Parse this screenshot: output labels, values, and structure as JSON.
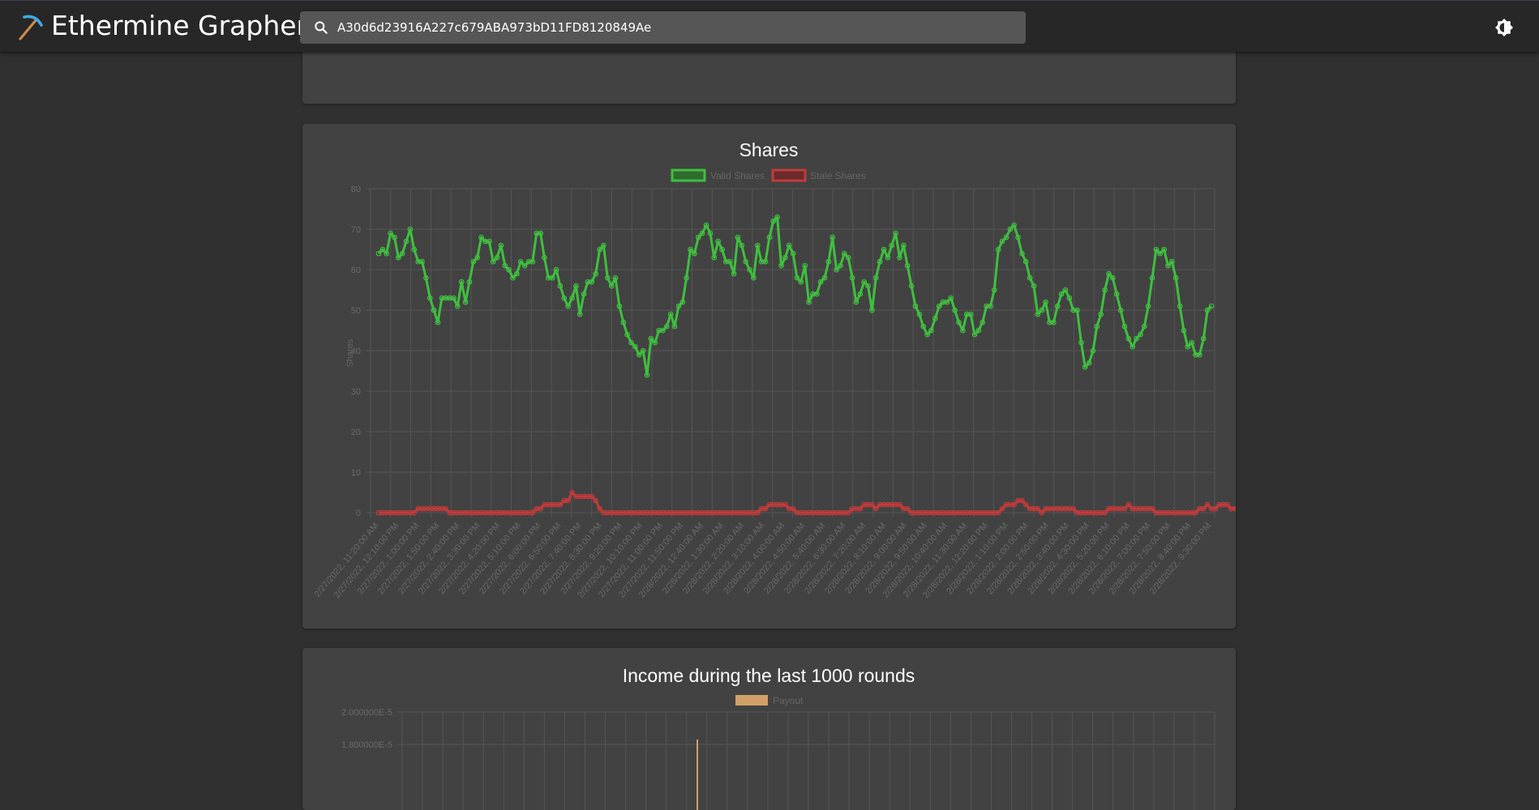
{
  "app": {
    "title": "Ethermine Grapher"
  },
  "search": {
    "value": "A30d6d23916A227c679ABA973bD11FD8120849Ae",
    "placeholder": ""
  },
  "icons": {
    "logo": "pickaxe-icon",
    "search": "search-icon",
    "theme": "brightness-icon"
  },
  "colors": {
    "valid": "#3fbf3f",
    "stale": "#c23b3b",
    "payout": "#d0a068",
    "grid": "#555555",
    "tick": "#6a6a6a"
  },
  "top_chart": {
    "tick_labels": [
      "2/27/2022",
      "2/27/2022",
      "2/27/2022",
      "2/27/2022",
      "2/27/2022",
      "2/27/2022",
      "2/27/2022",
      "2/27/2022",
      "2/27/2022",
      "2/27/2022",
      "2/27/2022",
      "2/27/2022",
      "2/27/2022",
      "2/27/2022",
      "2/28/2022",
      "2/28/2022",
      "2/28/2022",
      "2/28/2022",
      "2/28/2022",
      "2/28/2022",
      "2/28/2022",
      "2/28/2022",
      "2/28/2022",
      "2/28/2022",
      "2/28/2022",
      "2/28/2022",
      "2/28/2022",
      "2/28/2022",
      "2/28/2022",
      "2/28/2022",
      "2/28/2022",
      "2/28/2022",
      "2/28/2022",
      "2/28/2022",
      "2/28/2022"
    ]
  },
  "chart_data": [
    {
      "type": "line",
      "title": "Shares",
      "ylabel": "Shares",
      "ylim": [
        0,
        80
      ],
      "yticks": [
        80,
        70,
        60,
        50,
        40,
        30,
        20,
        10,
        0
      ],
      "grid": true,
      "legend_placement": "top",
      "x_ticks": [
        "2/27/2022, 11:20:00 AM",
        "2/27/2022, 12:10:00 PM",
        "2/27/2022, 1:00:00 PM",
        "2/27/2022, 1:50:00 PM",
        "2/27/2022, 2:40:00 PM",
        "2/27/2022, 3:30:00 PM",
        "2/27/2022, 4:20:00 PM",
        "2/27/2022, 5:10:00 PM",
        "2/27/2022, 6:00:00 PM",
        "2/27/2022, 6:50:00 PM",
        "2/27/2022, 7:40:00 PM",
        "2/27/2022, 8:30:00 PM",
        "2/27/2022, 9:20:00 PM",
        "2/27/2022, 10:10:00 PM",
        "2/27/2022, 11:00:00 PM",
        "2/27/2022, 11:50:00 PM",
        "2/28/2022, 12:40:00 AM",
        "2/28/2022, 1:30:00 AM",
        "2/28/2022, 2:20:00 AM",
        "2/28/2022, 3:10:00 AM",
        "2/28/2022, 4:00:00 AM",
        "2/28/2022, 4:50:00 AM",
        "2/28/2022, 5:40:00 AM",
        "2/28/2022, 6:30:00 AM",
        "2/28/2022, 7:20:00 AM",
        "2/28/2022, 8:10:00 AM",
        "2/28/2022, 9:00:00 AM",
        "2/28/2022, 9:50:00 AM",
        "2/28/2022, 10:40:00 AM",
        "2/28/2022, 11:30:00 AM",
        "2/28/2022, 12:20:00 PM",
        "2/28/2022, 1:10:00 PM",
        "2/28/2022, 2:00:00 PM",
        "2/28/2022, 2:50:00 PM",
        "2/28/2022, 3:40:00 PM",
        "2/28/2022, 4:30:00 PM",
        "2/28/2022, 5:20:00 PM",
        "2/28/2022, 6:10:00 PM",
        "2/28/2022, 7:00:00 PM",
        "2/28/2022, 7:50:00 PM",
        "2/28/2022, 8:40:00 PM",
        "2/28/2022, 9:30:00 PM"
      ],
      "series": [
        {
          "name": "Valid Shares",
          "values": [
            64,
            65,
            64,
            69,
            68,
            63,
            64,
            67,
            70,
            65,
            62,
            62,
            58,
            53,
            50,
            47,
            53,
            53,
            53,
            53,
            51,
            57,
            52,
            57,
            62,
            63,
            68,
            67,
            67,
            62,
            63,
            66,
            61,
            60,
            58,
            59,
            62,
            61,
            62,
            62,
            69,
            69,
            63,
            58,
            58,
            60,
            56,
            53,
            51,
            53,
            56,
            49,
            54,
            57,
            57,
            59,
            65,
            66,
            58,
            56,
            58,
            51,
            47,
            44,
            42,
            41,
            39,
            40,
            34,
            43,
            42,
            45,
            45,
            46,
            49,
            46,
            51,
            52,
            58,
            65,
            64,
            68,
            69,
            71,
            69,
            63,
            67,
            65,
            62,
            62,
            59,
            68,
            66,
            62,
            60,
            58,
            66,
            62,
            62,
            68,
            72,
            73,
            61,
            63,
            66,
            64,
            58,
            57,
            61,
            52,
            54,
            54,
            57,
            58,
            62,
            68,
            60,
            61,
            64,
            63,
            58,
            52,
            54,
            57,
            56,
            50,
            58,
            62,
            65,
            63,
            66,
            69,
            63,
            66,
            61,
            56,
            51,
            49,
            46,
            44,
            45,
            48,
            51,
            52,
            52,
            53,
            50,
            47,
            45,
            49,
            49,
            44,
            45,
            47,
            51,
            51,
            55,
            65,
            67,
            68,
            70,
            71,
            68,
            64,
            62,
            58,
            56,
            49,
            50,
            52,
            47,
            47,
            51,
            54,
            55,
            53,
            50,
            50,
            42,
            36,
            37,
            40,
            46,
            49,
            55,
            59,
            58,
            54,
            50,
            46,
            43,
            41,
            43,
            44,
            46,
            51,
            58,
            65,
            64,
            65,
            61,
            62,
            58,
            51,
            45,
            41,
            42,
            39,
            39,
            43,
            50,
            51
          ]
        },
        {
          "name": "Stale Shares",
          "values": [
            0,
            0,
            0,
            0,
            0,
            0,
            0,
            0,
            0,
            0,
            1,
            1,
            1,
            1,
            1,
            1,
            1,
            1,
            0,
            0,
            0,
            0,
            0,
            0,
            0,
            0,
            0,
            0,
            0,
            0,
            0,
            0,
            0,
            0,
            0,
            0,
            0,
            0,
            0,
            0,
            1,
            1,
            2,
            2,
            2,
            2,
            2,
            3,
            3,
            5,
            4,
            4,
            4,
            4,
            4,
            3,
            1,
            0,
            0,
            0,
            0,
            0,
            0,
            0,
            0,
            0,
            0,
            0,
            0,
            0,
            0,
            0,
            0,
            0,
            0,
            0,
            0,
            0,
            0,
            0,
            0,
            0,
            0,
            0,
            0,
            0,
            0,
            0,
            0,
            0,
            0,
            0,
            0,
            0,
            0,
            0,
            0,
            1,
            1,
            2,
            2,
            2,
            2,
            2,
            1,
            1,
            0,
            0,
            0,
            0,
            0,
            0,
            0,
            0,
            0,
            0,
            0,
            0,
            0,
            0,
            1,
            1,
            1,
            2,
            2,
            2,
            1,
            2,
            2,
            2,
            2,
            2,
            2,
            1,
            1,
            0,
            0,
            0,
            0,
            0,
            0,
            0,
            0,
            0,
            0,
            0,
            0,
            0,
            0,
            0,
            0,
            0,
            0,
            0,
            0,
            0,
            0,
            0,
            1,
            2,
            2,
            2,
            3,
            3,
            2,
            1,
            1,
            1,
            0,
            1,
            1,
            1,
            1,
            1,
            1,
            1,
            1,
            0,
            0,
            0,
            0,
            0,
            0,
            0,
            0,
            1,
            1,
            1,
            1,
            1,
            2,
            1,
            1,
            1,
            1,
            1,
            1,
            0,
            0,
            0,
            0,
            0,
            0,
            0,
            0,
            0,
            0,
            0,
            1,
            1,
            2,
            1,
            1,
            2,
            2,
            2,
            1,
            1,
            1,
            1,
            1,
            1,
            1,
            1,
            1,
            1,
            1,
            0,
            0,
            0,
            0,
            0,
            0,
            1,
            1,
            1,
            1,
            1,
            1,
            1,
            0,
            0,
            0,
            0,
            0,
            0,
            0
          ]
        }
      ]
    },
    {
      "type": "bar",
      "title": "Income during the last 1000 rounds",
      "yticks": [
        "2.000000E-5",
        "1.800000E-5"
      ],
      "legend_placement": "top",
      "series": [
        {
          "name": "Payout"
        }
      ]
    }
  ]
}
